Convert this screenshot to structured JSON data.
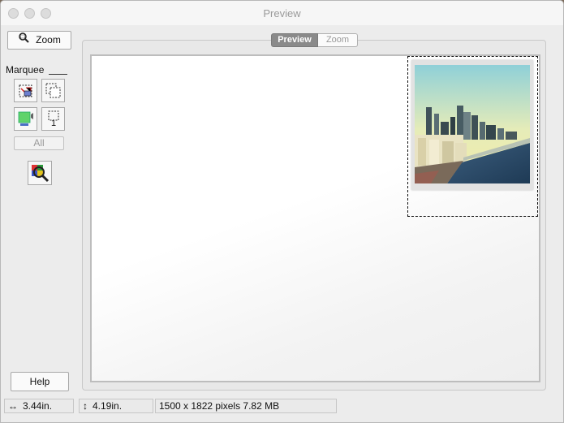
{
  "window": {
    "title": "Preview"
  },
  "sidebar": {
    "zoom_label": "Zoom",
    "marquee_label": "Marquee",
    "marquee_count": "1",
    "all_label": "All",
    "help_label": "Help"
  },
  "tabs": [
    {
      "label": "Preview",
      "selected": true
    },
    {
      "label": "Zoom",
      "selected": false
    }
  ],
  "status": {
    "width": "3.44in.",
    "height": "4.19in.",
    "info": "1500 x 1822 pixels 7.82 MB"
  },
  "colors": {
    "selected_tab": "#8a8a8a",
    "window_bg": "#ececec",
    "canvas_bg": "#ffffff"
  },
  "icons": {
    "zoom": "magnifier-icon",
    "marquee_tools": [
      "auto-locate-icon",
      "copy-marquee-icon",
      "image-adjust-icon",
      "marquee-count-icon"
    ],
    "histogram": "color-magnifier-icon"
  }
}
